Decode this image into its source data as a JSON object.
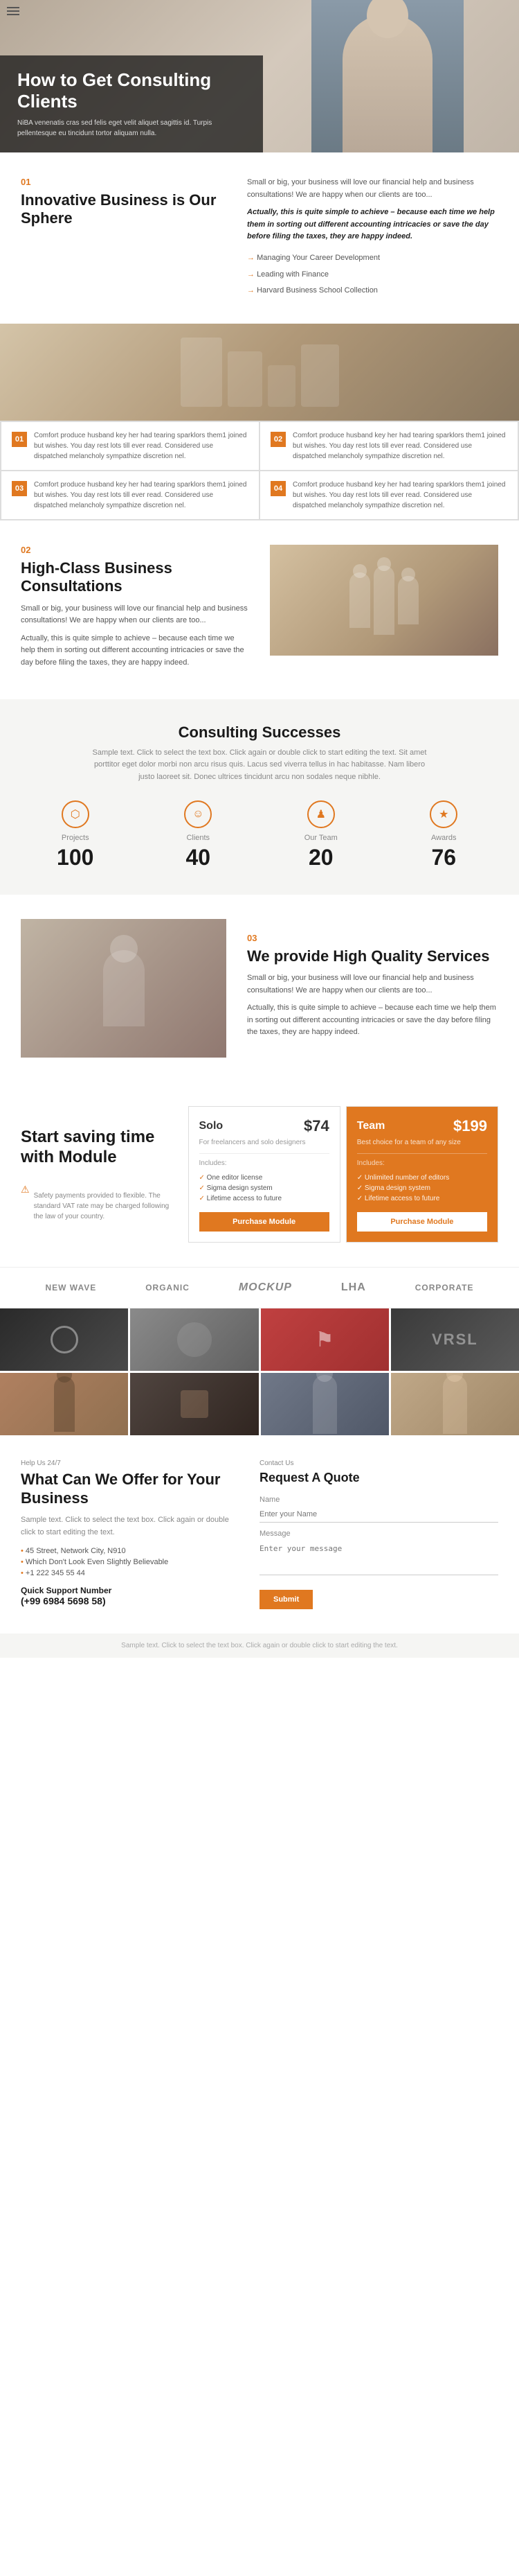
{
  "hamburger": {
    "label": "menu"
  },
  "hero": {
    "title": "How to Get Consulting Clients",
    "subtitle": "NiBA venenatis cras sed felis eget velit aliquet sagittis id. Turpis pellentesque eu tincidunt tortor aliquam nulla."
  },
  "section01": {
    "number": "01",
    "title": "Innovative Business is Our Sphere",
    "description": "Small or big, your business will love our financial help and business consultations! We are happy when our clients are too...",
    "highlight": "Actually, this is quite simple to achieve – because each time we help them in sorting out different accounting intricacies or save the day before filing the taxes, they are happy indeed.",
    "list": [
      "Managing Your Career Development",
      "Leading with Finance",
      "Harvard Business School Collection"
    ]
  },
  "gridCards": [
    {
      "number": "01",
      "text": "Comfort produce husband key her had tearing sparklors them1 joined but wishes. You day rest lots till ever read. Considered use dispatched melancholy sympathize discretion nel."
    },
    {
      "number": "02",
      "text": "Comfort produce husband key her had tearing sparklors them1 joined but wishes. You day rest lots till ever read. Considered use dispatched melancholy sympathize discretion nel."
    },
    {
      "number": "03",
      "text": "Comfort produce husband key her had tearing sparklors them1 joined but wishes. You day rest lots till ever read. Considered use dispatched melancholy sympathize discretion nel."
    },
    {
      "number": "04",
      "text": "Comfort produce husband key her had tearing sparklors them1 joined but wishes. You day rest lots till ever read. Considered use dispatched melancholy sympathize discretion nel."
    }
  ],
  "section02": {
    "number": "02",
    "title": "High-Class Business Consultations",
    "description": "Small or big, your business will love our financial help and business consultations! We are happy when our clients are too...",
    "highlight": "Actually, this is quite simple to achieve – because each time we help them in sorting out different accounting intricacies or save the day before filing the taxes, they are happy indeed."
  },
  "stats": {
    "title": "Consulting Successes",
    "description": "Sample text. Click to select the text box. Click again or double click to start editing the text. Sit amet porttitor eget dolor morbi non arcu risus quis. Lacus sed viverra tellus in hac habitasse. Nam libero justo laoreet sit. Donec ultrices tincidunt arcu non sodales neque nibhle.",
    "items": [
      {
        "label": "Projects",
        "number": "100",
        "icon": "⬡"
      },
      {
        "label": "Clients",
        "number": "40",
        "icon": "☺"
      },
      {
        "label": "Our Team",
        "number": "20",
        "icon": "♟"
      },
      {
        "label": "Awards",
        "number": "76",
        "icon": "★"
      }
    ]
  },
  "section03": {
    "number": "03",
    "title": "We provide High Quality Services",
    "description": "Small or big, your business will love our financial help and business consultations! We are happy when our clients are too...",
    "highlight": "Actually, this is quite simple to achieve – because each time we help them in sorting out different accounting intricacies or save the day before filing the taxes, they are happy indeed."
  },
  "pricing": {
    "left_title": "Start saving time with Module",
    "note": "Safety payments provided to flexible. The standard VAT rate may be charged following the law of your country.",
    "plans": [
      {
        "name": "Solo",
        "price": "$74",
        "desc": "For freelancers and solo designers",
        "includes_label": "Includes:",
        "features": [
          "One editor license",
          "Sigma design system",
          "Lifetime access to future"
        ],
        "button": "Purchase Module",
        "is_featured": false
      },
      {
        "name": "Team",
        "price": "$199",
        "desc": "Best choice for a team of any size",
        "includes_label": "Includes:",
        "features": [
          "Unlimited number of editors",
          "Sigma design system",
          "Lifetime access to future"
        ],
        "button": "Purchase Module",
        "is_featured": true
      }
    ]
  },
  "logos": [
    {
      "name": "NEW WAVE"
    },
    {
      "name": "ORGANIC"
    },
    {
      "name": "Mockup"
    },
    {
      "name": "lha"
    },
    {
      "name": "CORPORATE"
    }
  ],
  "footer": {
    "help_label": "Help Us 24/7",
    "main_title": "What Can We Offer for Your Business",
    "desc": "Sample text. Click to select the text box. Click again or double click to start editing the text.",
    "list": [
      "45 Street, Network City, N910",
      "Which Don't Look Even Slightly Believable",
      "+1 222 345 55 44"
    ],
    "support_label": "Quick Support Number",
    "phone": "(+99 6984 5698 58)",
    "contact_label": "Contact Us",
    "contact_title": "Request A Quote",
    "form": {
      "name_label": "Name",
      "name_placeholder": "Enter your Name",
      "message_label": "Message",
      "message_placeholder": "Enter your message",
      "submit": "Submit"
    }
  },
  "footer_bottom": {
    "text": "Sample text. Click to select the text box. Click again or double click to start editing the text."
  }
}
